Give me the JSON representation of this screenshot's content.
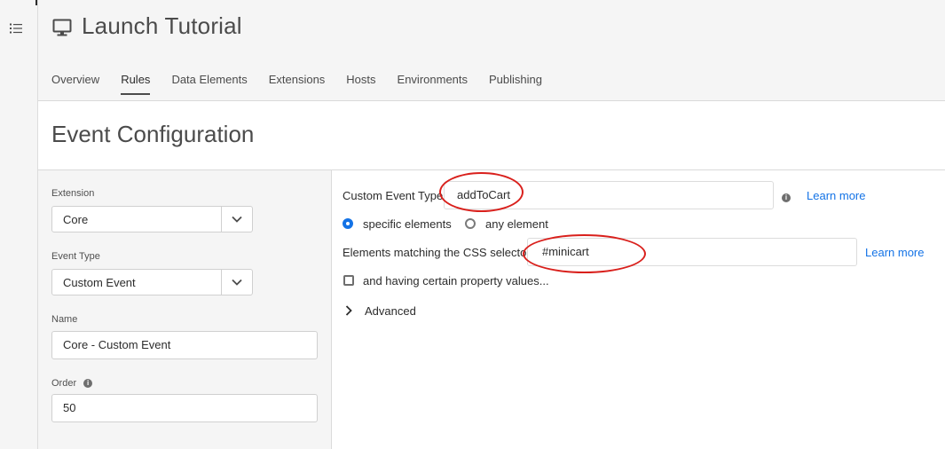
{
  "header": {
    "title": "Launch Tutorial",
    "tabs": [
      "Overview",
      "Rules",
      "Data Elements",
      "Extensions",
      "Hosts",
      "Environments",
      "Publishing"
    ],
    "active_tab": "Rules"
  },
  "page": {
    "title": "Event Configuration"
  },
  "left": {
    "extension_label": "Extension",
    "extension_value": "Core",
    "event_type_label": "Event Type",
    "event_type_value": "Custom Event",
    "name_label": "Name",
    "name_value": "Core - Custom Event",
    "order_label": "Order",
    "order_value": "50"
  },
  "right": {
    "custom_event_label": "Custom Event Type",
    "custom_event_value": "addToCart",
    "learn_more_1": "Learn more",
    "radio_specific": "specific elements",
    "radio_any": "any element",
    "css_selector_label": "Elements matching the CSS selector",
    "css_selector_value": "#minicart",
    "learn_more_2": "Learn more",
    "property_values_label": "and having certain property values...",
    "advanced_label": "Advanced"
  },
  "colors": {
    "accent": "#1473e6",
    "annotation": "#d9201c"
  },
  "icons": [
    "menu-list-icon",
    "monitor-icon",
    "chevron-down-icon",
    "info-icon",
    "chevron-right-icon"
  ]
}
